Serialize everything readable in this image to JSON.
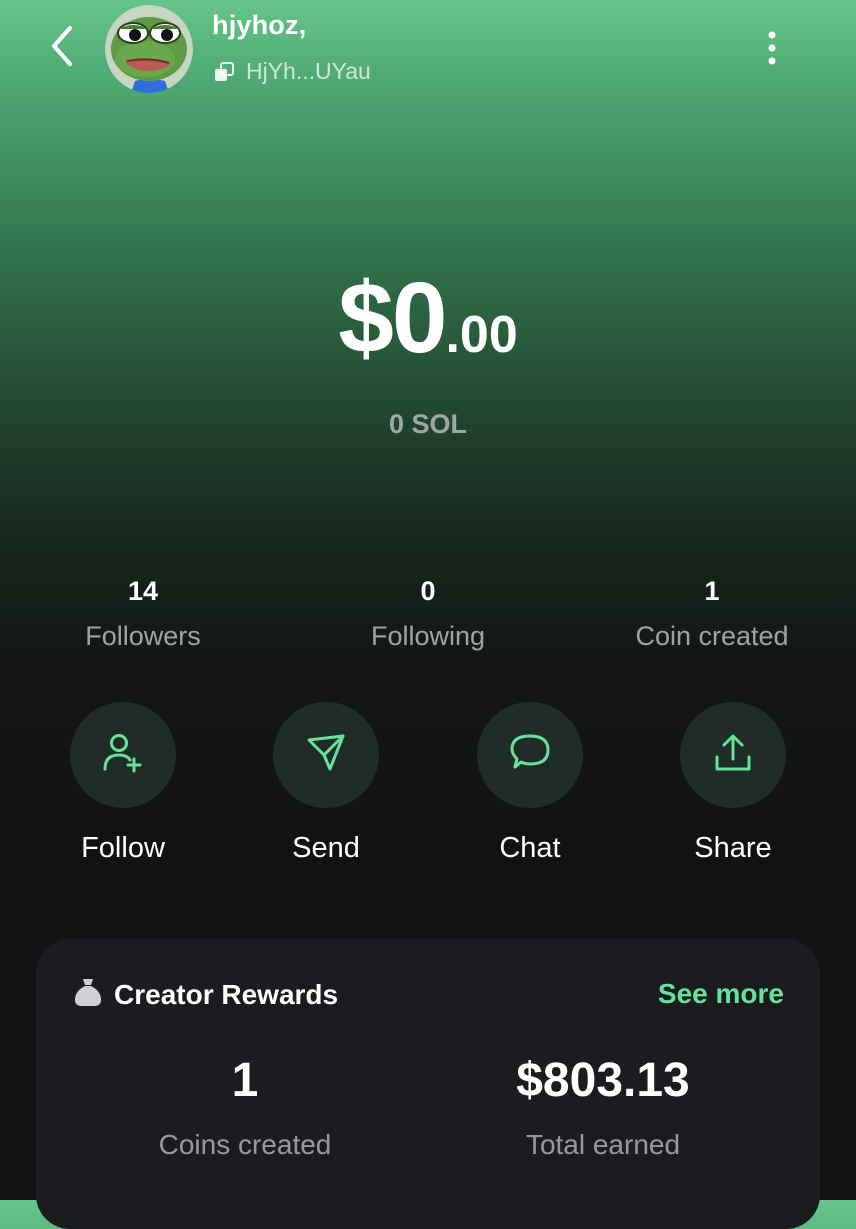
{
  "header": {
    "username": "hjyhoz,",
    "address": "HjYh...UYau",
    "back_icon": "chevron-left-icon",
    "copy_icon": "copy-icon",
    "more_icon": "more-vertical-icon",
    "avatar": "frog-avatar"
  },
  "balance": {
    "dollars": "$0",
    "cents": ".00",
    "sol": "0 SOL"
  },
  "stats": [
    {
      "value": "14",
      "label": "Followers"
    },
    {
      "value": "0",
      "label": "Following"
    },
    {
      "value": "1",
      "label": "Coin created"
    }
  ],
  "actions": [
    {
      "label": "Follow",
      "icon": "user-plus-icon"
    },
    {
      "label": "Send",
      "icon": "send-icon"
    },
    {
      "label": "Chat",
      "icon": "chat-icon"
    },
    {
      "label": "Share",
      "icon": "share-icon"
    }
  ],
  "rewards": {
    "icon": "money-bag-icon",
    "title": "Creator Rewards",
    "see_more": "See more",
    "coins_created_value": "1",
    "coins_created_label": "Coins created",
    "total_earned_value": "$803.13",
    "total_earned_label": "Total earned"
  },
  "colors": {
    "accent": "#67e29a",
    "gradient_top": "#66c58a",
    "background": "#121214",
    "card": "#1c1c20",
    "action_circle": "#1f2c28"
  }
}
